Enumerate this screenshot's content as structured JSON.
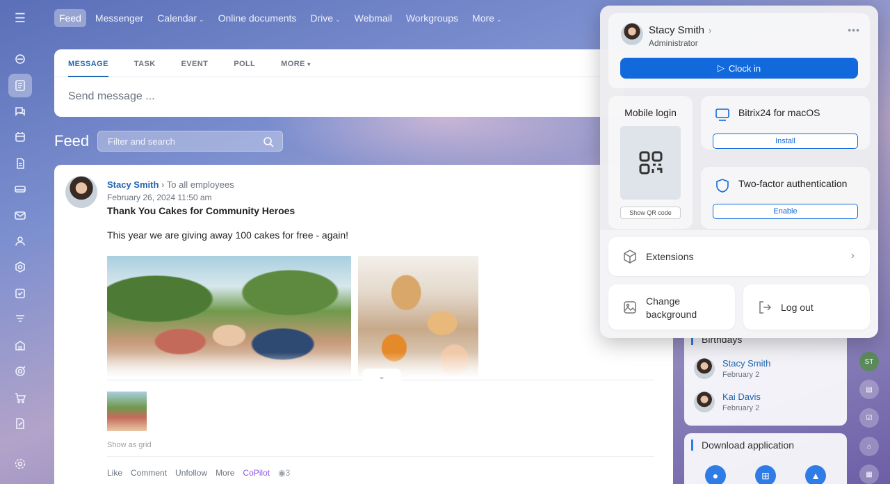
{
  "nav": {
    "tabs": [
      {
        "label": "Feed",
        "caret": false
      },
      {
        "label": "Messenger",
        "caret": false
      },
      {
        "label": "Calendar",
        "caret": true
      },
      {
        "label": "Online documents",
        "caret": false
      },
      {
        "label": "Drive",
        "caret": true
      },
      {
        "label": "Webmail",
        "caret": false
      },
      {
        "label": "Workgroups",
        "caret": false
      },
      {
        "label": "More",
        "caret": true
      }
    ]
  },
  "composer": {
    "tabs": [
      "MESSAGE",
      "TASK",
      "EVENT",
      "POLL",
      "MORE"
    ],
    "placeholder": "Send message ..."
  },
  "feed": {
    "title": "Feed",
    "filter_placeholder": "Filter and search"
  },
  "post": {
    "author": "Stacy Smith",
    "audience": "To all employees",
    "date": "February 26, 2024 11:50 am",
    "title": "Thank You Cakes for Community Heroes",
    "text": "This year we are giving away 100 cakes for free - again!",
    "show_grid": "Show as grid",
    "actions": {
      "like": "Like",
      "comment": "Comment",
      "unfollow": "Unfollow",
      "more": "More",
      "copilot": "CoPilot",
      "views": "3"
    }
  },
  "birthdays": {
    "title": "Birthdays",
    "people": [
      {
        "name": "Stacy Smith",
        "date": "February 2"
      },
      {
        "name": "Kai Davis",
        "date": "February 2"
      }
    ]
  },
  "download": {
    "title": "Download application"
  },
  "right_strip": {
    "initials": "ST"
  },
  "menu": {
    "user_name": "Stacy Smith",
    "user_role": "Administrator",
    "clock_in": "Clock in",
    "mobile_login": "Mobile login",
    "show_qr": "Show QR code",
    "mac_title": "Bitrix24 for macOS",
    "mac_button": "Install",
    "tfa_title": "Two-factor authentication",
    "tfa_button": "Enable",
    "extensions": "Extensions",
    "change_background": "Change background",
    "log_out": "Log out"
  },
  "colors": {
    "accent": "#1169dc",
    "link": "#2066b0",
    "copilot": "#8e52ec"
  }
}
